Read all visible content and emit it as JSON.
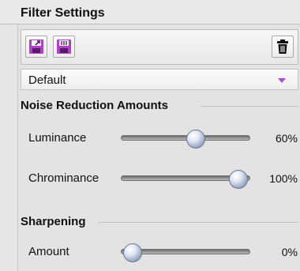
{
  "panel": {
    "title": "Filter Settings"
  },
  "toolbar": {
    "import_icon": "floppy-import-icon",
    "export_icon": "floppy-export-icon",
    "delete_icon": "trash-icon",
    "icon_color": "#b040c8"
  },
  "preset": {
    "selected": "Default",
    "accent": "#b04ad6"
  },
  "noise_reduction": {
    "title": "Noise Reduction Amounts",
    "luminance": {
      "label": "Luminance",
      "value_text": "60%",
      "value": 60
    },
    "chrominance": {
      "label": "Chrominance",
      "value_text": "100%",
      "value": 100
    }
  },
  "sharpening": {
    "title": "Sharpening",
    "amount": {
      "label": "Amount",
      "value_text": "0%",
      "value": 0
    }
  }
}
